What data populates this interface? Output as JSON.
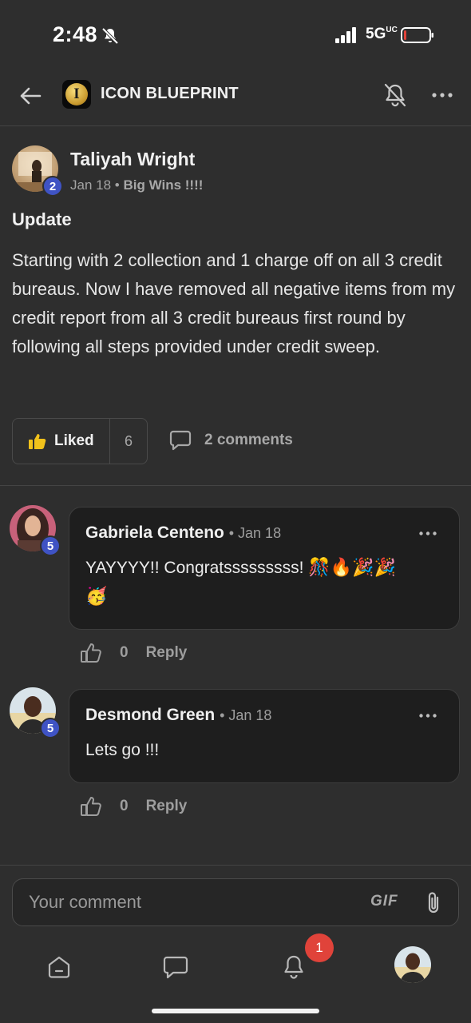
{
  "status_bar": {
    "time": "2:48",
    "network": "5G",
    "network_suffix": "UC"
  },
  "header": {
    "group_name": "ICON BLUEPRINT",
    "logo_letter": "I",
    "icons": {
      "back": "arrow-left-icon",
      "notifications": "bell-off-icon",
      "more": "more-horizontal-icon"
    }
  },
  "post": {
    "author": "Taliyah Wright",
    "author_level": "2",
    "date": "Jan 18",
    "separator": "•",
    "category": "Big Wins !!!!",
    "title": "Update",
    "body": "Starting with 2 collection and 1 charge off on all 3 credit bureaus. Now I have removed all negative items from my credit report from all 3 credit bureaus first round by following all steps provided under credit sweep.",
    "like_label": "Liked",
    "like_count": "6",
    "comments_label": "2 comments"
  },
  "comments": [
    {
      "author": "Gabriela Centeno",
      "level": "5",
      "date": "• Jan 18",
      "text": "YAYYYY!! Congratsssssssss!",
      "emojis_line1": "🎊🔥🎉🎉",
      "emojis_line2": "🥳",
      "like_count": "0",
      "reply_label": "Reply"
    },
    {
      "author": "Desmond Green",
      "level": "5",
      "date": "• Jan 18",
      "text": "Lets go !!!",
      "like_count": "0",
      "reply_label": "Reply"
    }
  ],
  "composer": {
    "placeholder": "Your comment",
    "gif_label": "GIF"
  },
  "bottom_nav": {
    "items": [
      "home-icon",
      "chat-icon",
      "notifications-icon",
      "profile-avatar"
    ],
    "notification_count": "1"
  },
  "colors": {
    "background": "#2e2e2e",
    "bubble": "#1e1e1e",
    "level_badge": "#3f53c4",
    "notification_badge": "#e0433a",
    "liked_thumb": "#f2c21b"
  }
}
